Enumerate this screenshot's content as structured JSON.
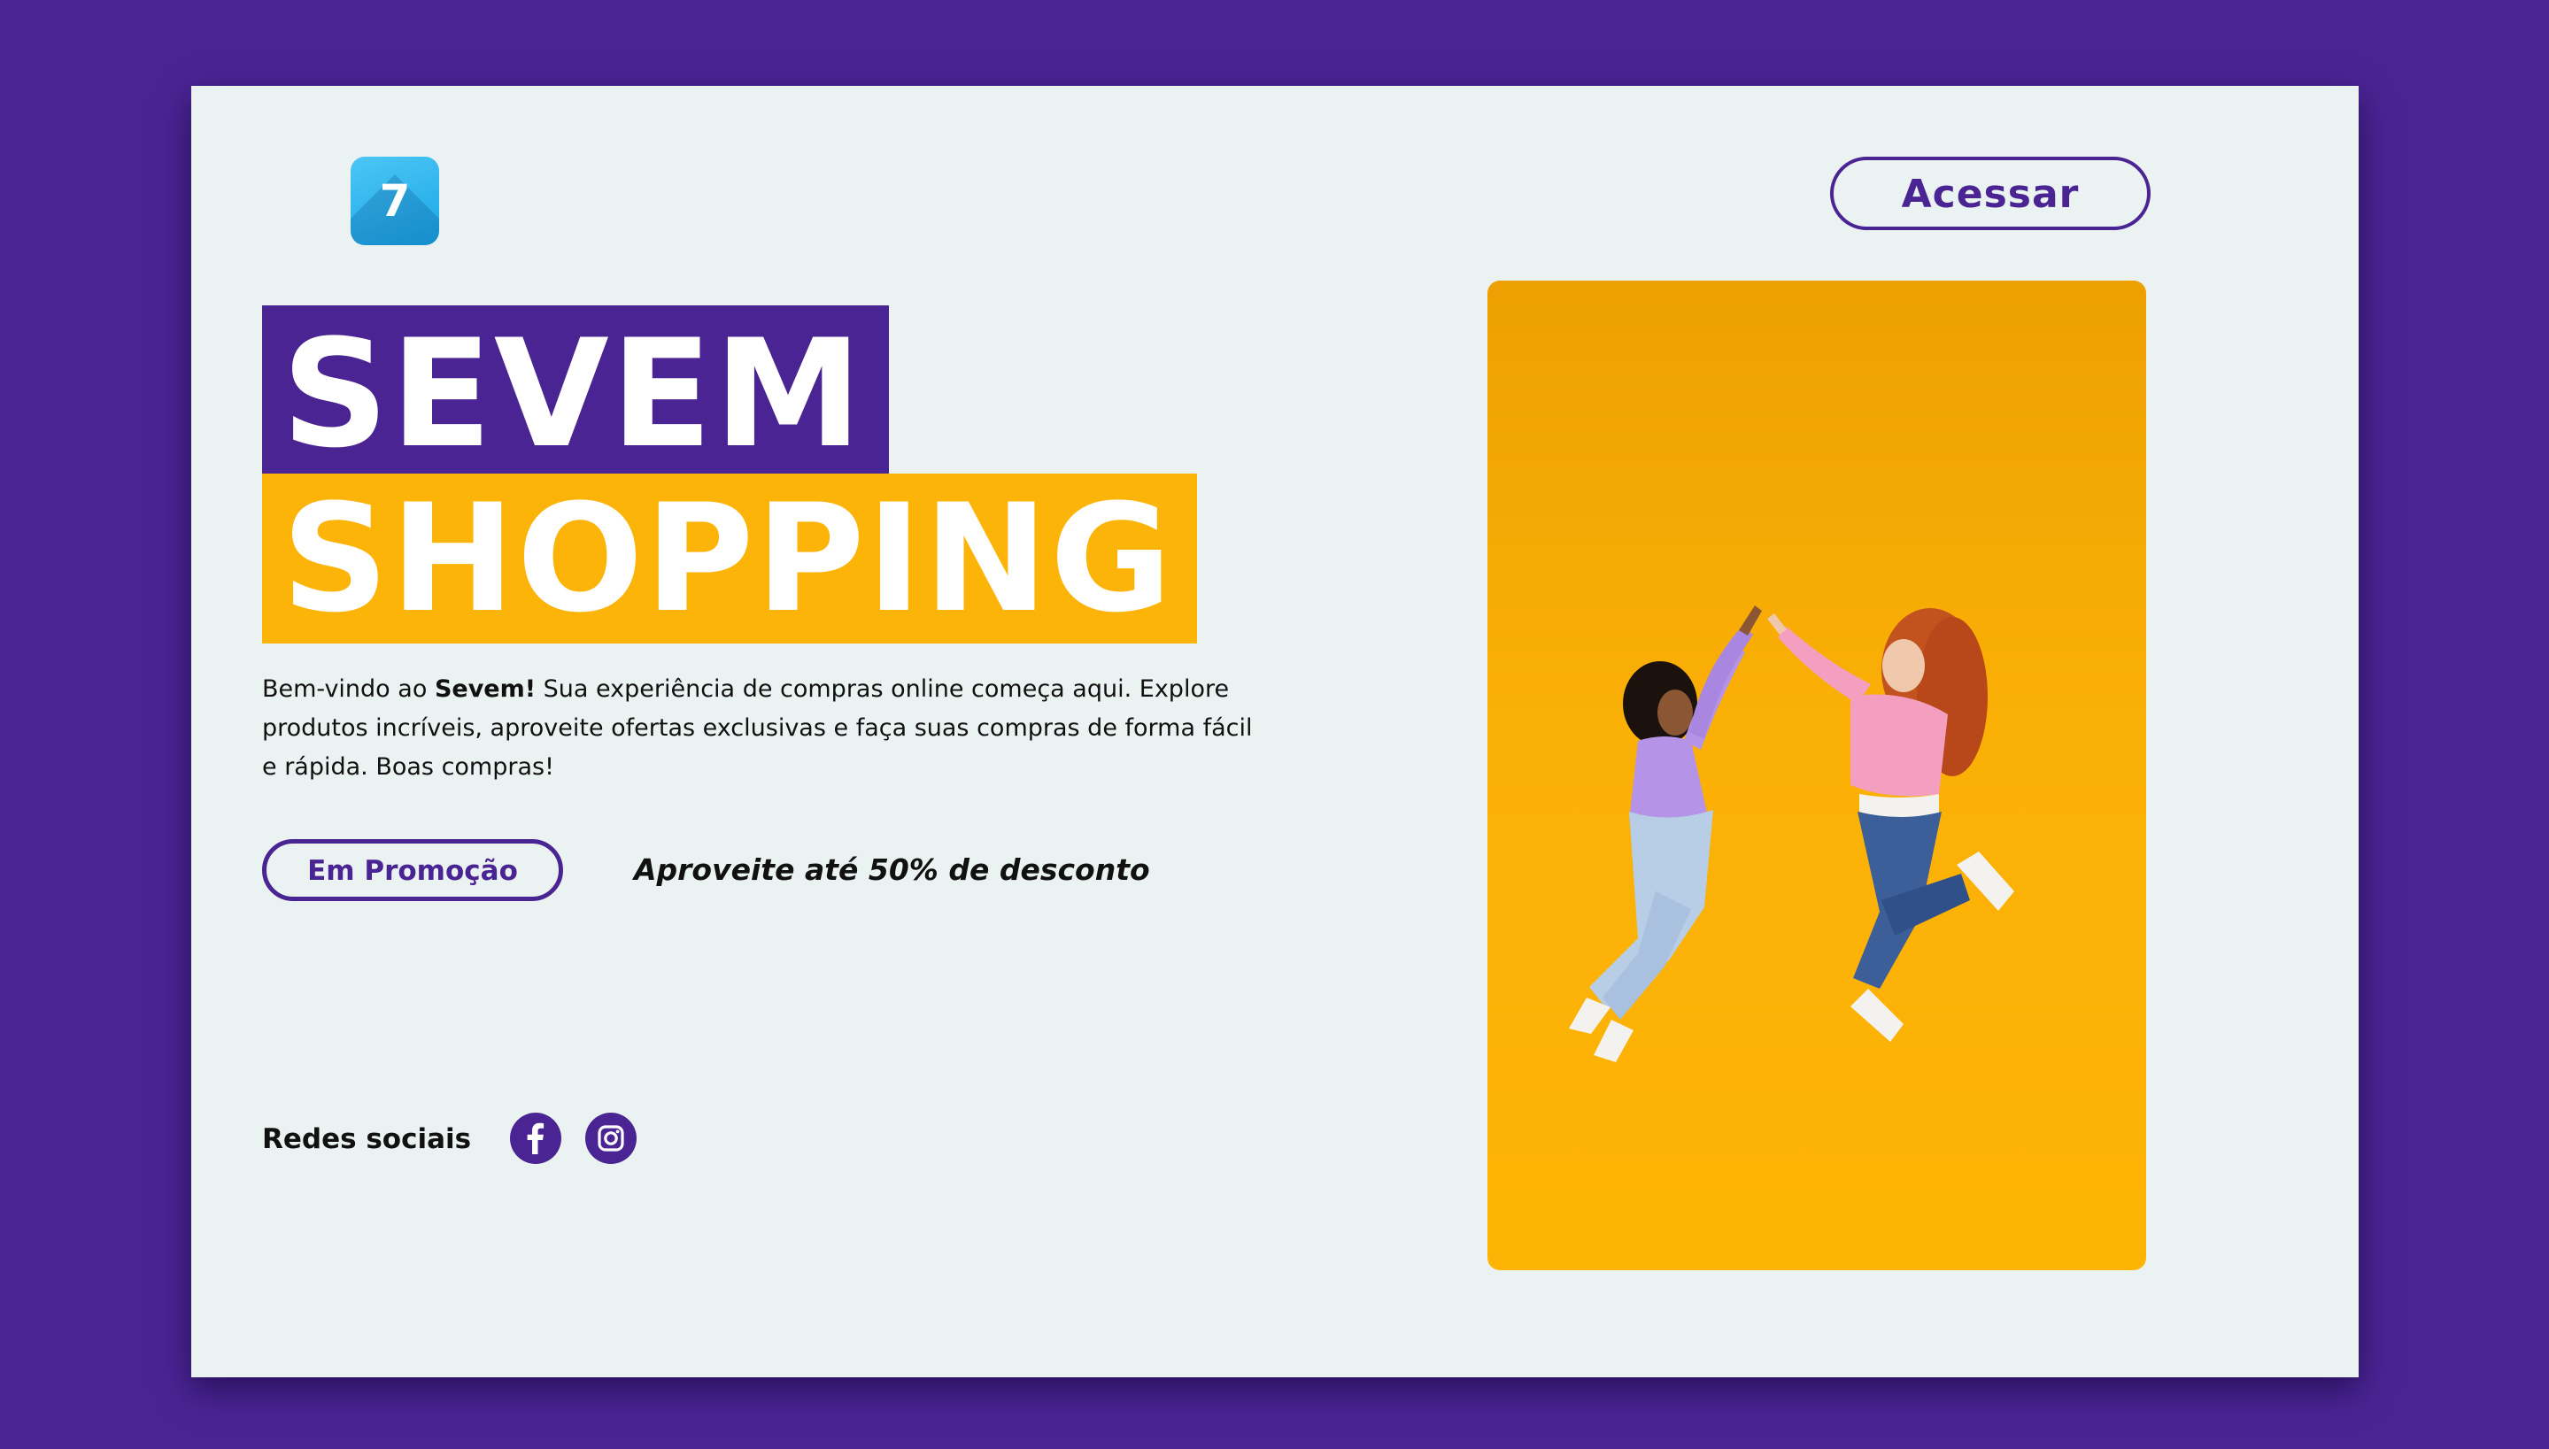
{
  "header": {
    "logo_text": "7",
    "login_label": "Acessar"
  },
  "hero": {
    "title_line1": "SEVEM",
    "title_line2": "SHOPPING",
    "welcome_prefix": "Bem-vindo ao ",
    "welcome_brand": "Sevem!",
    "welcome_text": " Sua experiência de compras online começa aqui. Explore produtos incríveis, aproveite ofertas exclusivas e faça suas compras de forma fácil e rápida. Boas compras!",
    "promo_label": "Em Promoção",
    "discount_text": "Aproveite até 50% de desconto"
  },
  "social": {
    "label": "Redes sociais",
    "icons": [
      "facebook-icon",
      "instagram-icon"
    ]
  },
  "colors": {
    "purple": "#4b2494",
    "yellow": "#fdb409",
    "card_background": "#ebf3f2",
    "logo_blue": "#1aa6e6"
  }
}
